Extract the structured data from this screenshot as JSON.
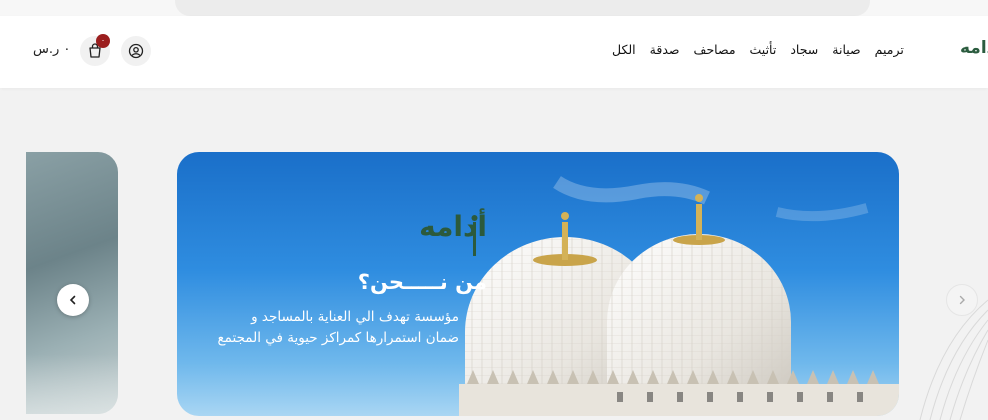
{
  "header": {
    "logo_text": "أدامه",
    "nav": [
      "ترميم",
      "صيانة",
      "سجاد",
      "تأثيث",
      "مصاحف",
      "صدقة",
      "الكل"
    ],
    "currency": "٠ ر.س",
    "cart_count": "٠"
  },
  "hero": {
    "brand": "أدامه",
    "headline": "من نـــــحن؟",
    "description": "مؤسسة تهدف الي العناية بالمساجد و ضمان استمرارها كمراكز حيوية في المجتمع"
  },
  "icons": {
    "cart": "shopping-bag-icon",
    "account": "user-icon",
    "prev": "chevron-left-icon",
    "next": "chevron-right-icon"
  },
  "colors": {
    "brand_green": "#2b5c3f",
    "badge_red": "#9b1e1e",
    "sky_blue": "#2f8de0"
  }
}
